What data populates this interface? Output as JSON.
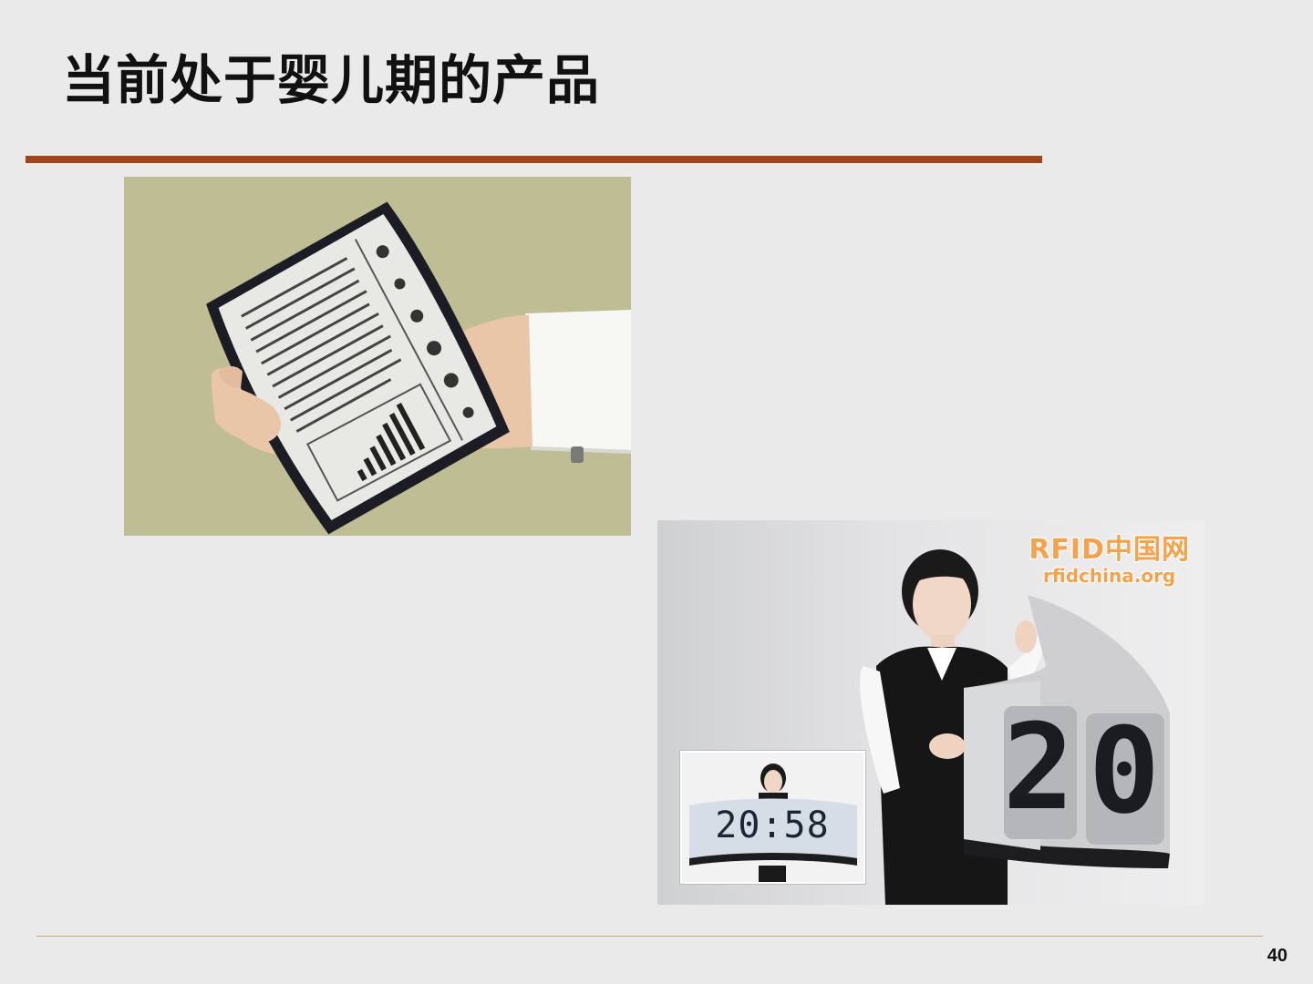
{
  "slide": {
    "title": "当前处于婴儿期的产品",
    "page_number": "40"
  },
  "colors": {
    "title_rule": "#a0441a",
    "footer_rule": "#c4ab72",
    "watermark": "#f6a24a"
  },
  "photo_clock": {
    "watermark_main": "RFID中国网",
    "watermark_sub": "rfidchina.org",
    "inset_time": "20:58",
    "large_digits": "20"
  }
}
